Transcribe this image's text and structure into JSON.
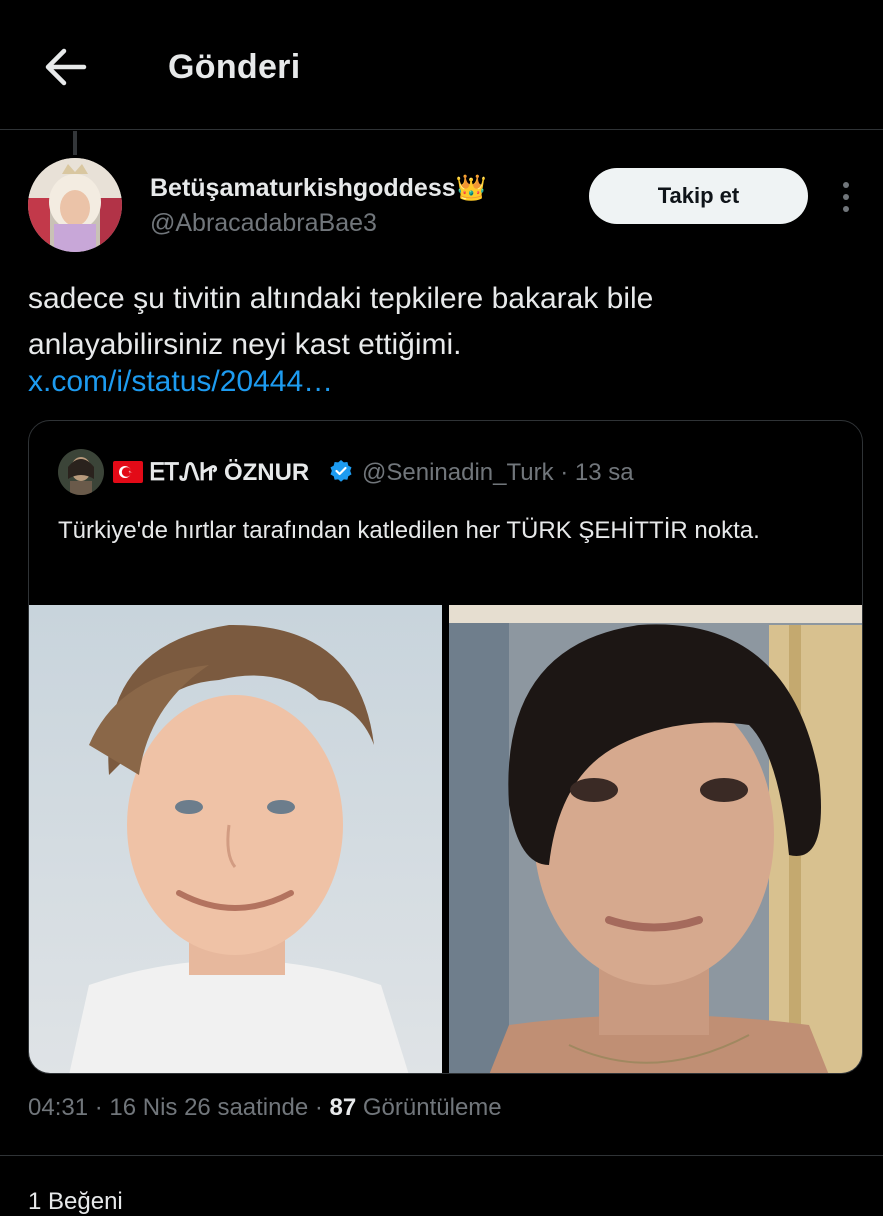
{
  "header": {
    "back_icon": "arrow-left-icon",
    "title": "Gönderi"
  },
  "post": {
    "author": {
      "name": "Betüşamaturkishgoddess",
      "emoji": "👑",
      "handle": "@AbracadabraBae3"
    },
    "follow_label": "Takip et",
    "more_icon": "more-vertical-icon",
    "text": "sadece şu tivitin altındaki tepkilere bakarak bile anlayabilirsiniz neyi kast ettiğimi.",
    "link": "x.com/i/status/20444…",
    "quoted": {
      "flag": "🇹🇷",
      "name": "𐰆𐰕𐰣𐰆𐰺 ÖZNUR",
      "name_display": "ᎬᎢᏁᏥ ÖZNUR",
      "verified_icon": "verified-badge-icon",
      "handle": "@Seninadin_Turk",
      "time": "· 13 sa",
      "text": "Türkiye'de hırtlar tarafından katledilen her TÜRK ŞEHİTTİR nokta."
    },
    "meta": {
      "time": "04:31 · 16 Nis 26 saatinde ·",
      "views_count": "87",
      "views_label": "Görüntüleme"
    },
    "peek": "1 Beğeni"
  },
  "colors": {
    "background": "#000000",
    "text": "#e7e9ea",
    "muted": "#71767b",
    "link": "#1d9bf0",
    "border": "#2f3336",
    "verified": "#1d9bf0"
  }
}
